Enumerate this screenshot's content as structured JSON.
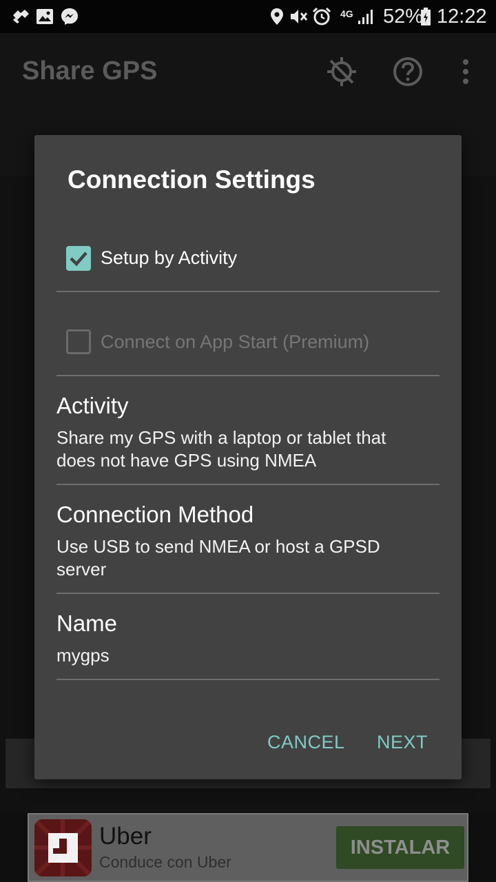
{
  "status_bar": {
    "battery": "52%",
    "time": "12:22",
    "network": "4G",
    "icons": [
      "tools-icon",
      "image-icon",
      "messenger-icon",
      "location-icon",
      "mute-icon",
      "alarm-icon",
      "signal-icon",
      "battery-icon"
    ]
  },
  "app_bar": {
    "title": "Share GPS",
    "icons": [
      "gps-off-icon",
      "help-icon",
      "overflow-menu-icon"
    ]
  },
  "dialog": {
    "title": "Connection Settings",
    "setup_by_activity": {
      "label": "Setup by Activity",
      "checked": true
    },
    "connect_on_start": {
      "label": "Connect on App Start (Premium)",
      "checked": false,
      "enabled": false
    },
    "activity": {
      "title": "Activity",
      "summary": "Share my GPS with a laptop or tablet that does not have GPS using NMEA"
    },
    "connection_method": {
      "title": "Connection Method",
      "summary": "Use USB to send NMEA or host a GPSD server"
    },
    "name": {
      "title": "Name",
      "value": "mygps"
    },
    "cancel_label": "CANCEL",
    "next_label": "NEXT",
    "accent_color": "#80cbc4"
  },
  "ad": {
    "app_name": "Uber",
    "tagline": "Conduce con Uber",
    "install_label": "INSTALAR"
  }
}
